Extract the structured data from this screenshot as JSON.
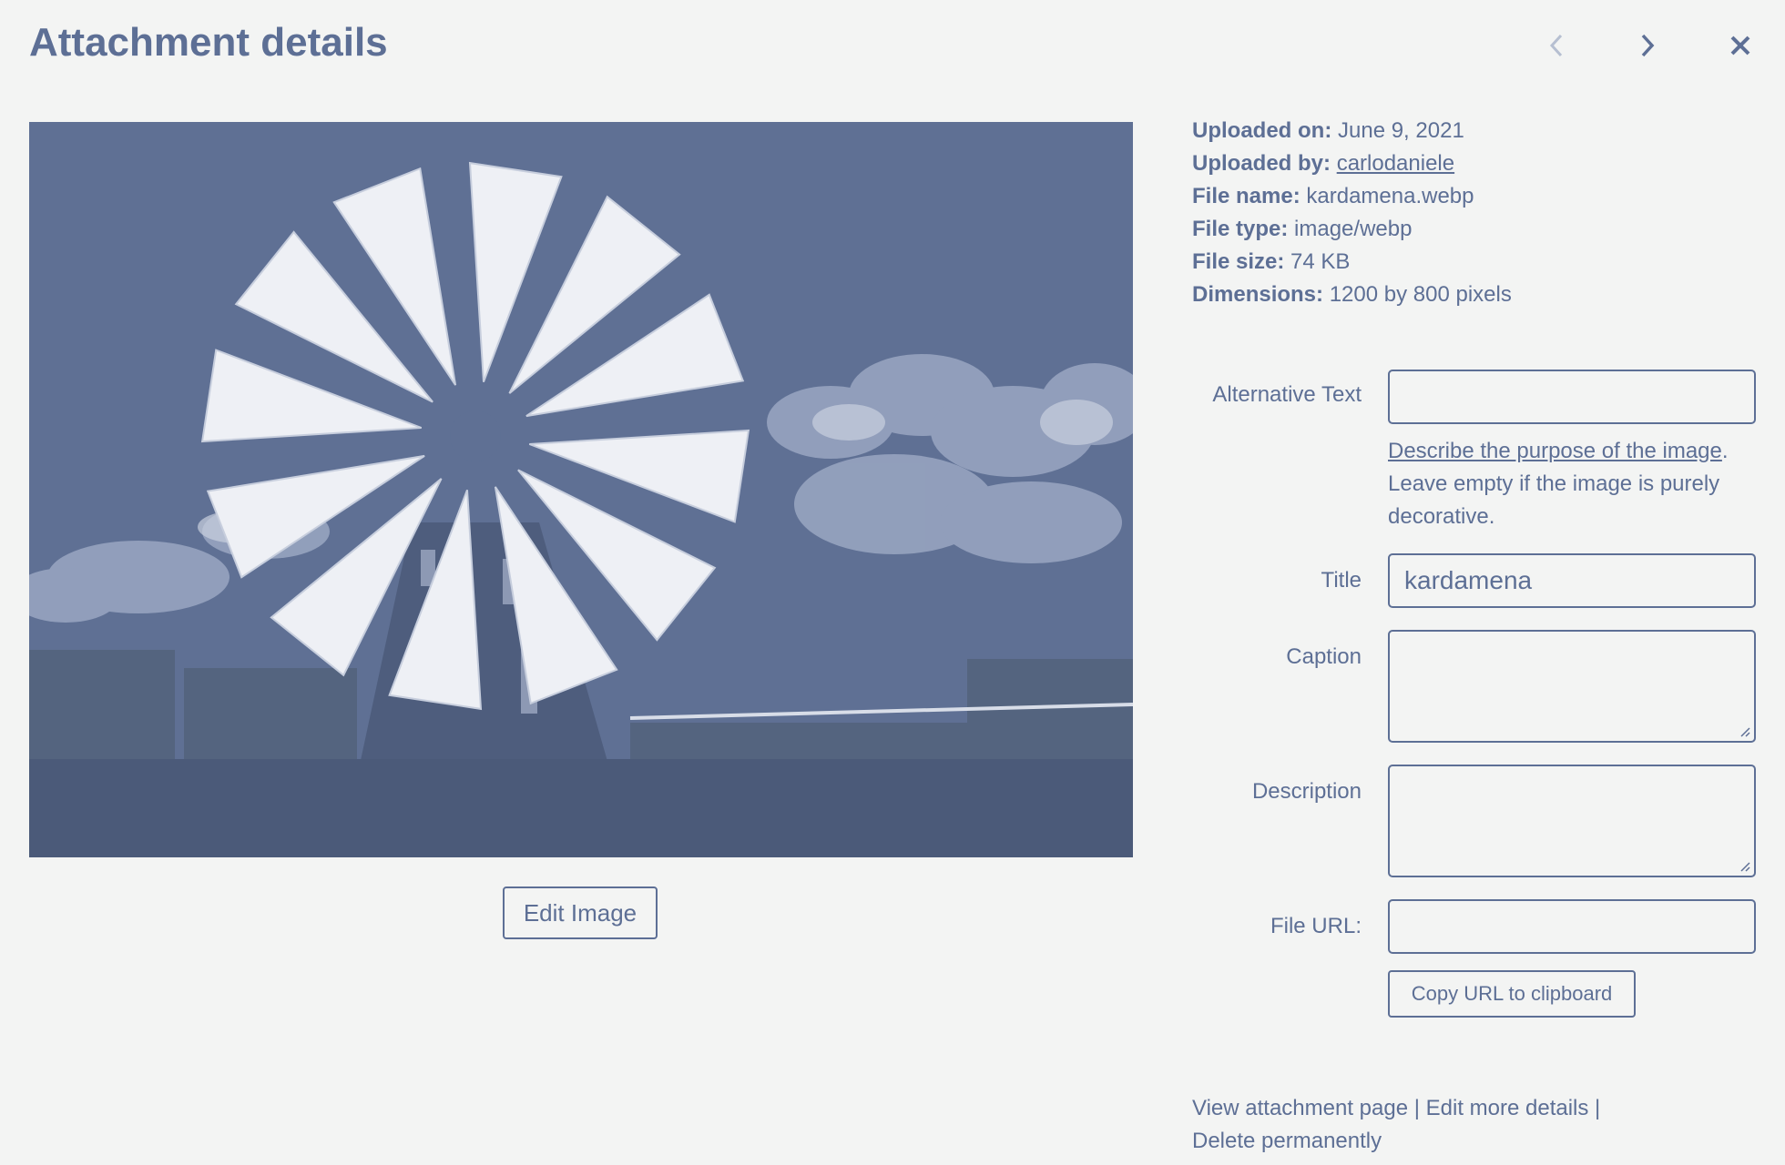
{
  "header": {
    "title": "Attachment details",
    "prev_icon": "chevron-left-icon",
    "next_icon": "chevron-right-icon",
    "close_icon": "close-icon"
  },
  "preview": {
    "alt": "Windmill with white sails against a cloudy sky",
    "edit_button": "Edit Image"
  },
  "meta": {
    "uploaded_on_label": "Uploaded on:",
    "uploaded_on": "June 9, 2021",
    "uploaded_by_label": "Uploaded by:",
    "uploaded_by": "carlodaniele",
    "file_name_label": "File name:",
    "file_name": "kardamena.webp",
    "file_type_label": "File type:",
    "file_type": "image/webp",
    "file_size_label": "File size:",
    "file_size": "74 KB",
    "dimensions_label": "Dimensions:",
    "dimensions": "1200 by 800 pixels"
  },
  "fields": {
    "alt_label": "Alternative Text",
    "alt_value": "",
    "alt_help_link": "Describe the purpose of the image",
    "alt_help_text": ". Leave empty if the image is purely decorative.",
    "title_label": "Title",
    "title_value": "kardamena",
    "caption_label": "Caption",
    "caption_value": "",
    "description_label": "Description",
    "description_value": "",
    "url_label": "File URL:",
    "url_value": "",
    "copy_button": "Copy URL to clipboard"
  },
  "actions": {
    "view": "View attachment page",
    "edit": "Edit more details",
    "delete": "Delete permanently",
    "separator": " | "
  },
  "colors": {
    "accent": "#5d6f95",
    "background": "#f3f4f3"
  }
}
